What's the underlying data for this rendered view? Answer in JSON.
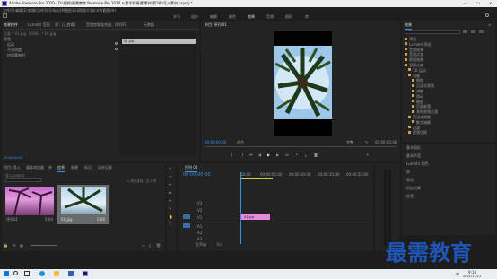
{
  "titlebar": {
    "title": "Adobe Premiere Pro 2020 - D:\\视频\\最需教育 Premiere Pro 2020 从零学到精通\\素材\\第3章\\导入素材.prproj *",
    "minimize": "—",
    "maximize": "☐",
    "close": "✕"
  },
  "menubar": [
    "文件(F)",
    "编辑(E)",
    "剪辑(C)",
    "序列(S)",
    "标记(M)",
    "图形(G)",
    "视图(V)",
    "窗口(W)",
    "帮助(H)"
  ],
  "workspaces": {
    "items": [
      "学习",
      "组件",
      "编辑",
      "颜色",
      "效果",
      "音频",
      "图形",
      "库"
    ],
    "active_index": 4
  },
  "source_panel": {
    "tabs": [
      "效果控件",
      "Lumetri 范围",
      "源：(无剪辑)",
      "音频剪辑混合器：序列01",
      "元数据"
    ],
    "active_index": 0,
    "sub_header": "主要 * 01.jpg",
    "sub_header2": "序列01 * 01.jpg",
    "video_label": "视频",
    "rows": [
      "运动",
      "不透明度",
      "时间重映射"
    ],
    "clip_label": "01.jpg",
    "timecode": "00:00:00:00"
  },
  "program_panel": {
    "tab": "节目: 序列 01",
    "timecode_left": "00:00:00:00",
    "fit": "适合",
    "quality": "完整",
    "timecode_right": "00:00:05:00"
  },
  "effects_panel": {
    "title": "效果",
    "search_placeholder": "",
    "tree": [
      {
        "label": "预设",
        "level": 0
      },
      {
        "label": "Lumetri 预设",
        "level": 0
      },
      {
        "label": "音频效果",
        "level": 0
      },
      {
        "label": "音频过渡",
        "level": 0
      },
      {
        "label": "视频效果",
        "level": 0
      },
      {
        "label": "视频过渡",
        "level": 0
      },
      {
        "label": "3D 运动",
        "level": 1
      },
      {
        "label": "划像",
        "level": 1
      },
      {
        "label": "擦除",
        "level": 2
      },
      {
        "label": "沉浸式视频",
        "level": 2
      },
      {
        "label": "溶解",
        "level": 2
      },
      {
        "label": "滑动",
        "level": 2
      },
      {
        "label": "缩放",
        "level": 2
      },
      {
        "label": "页面剥落",
        "level": 2
      },
      {
        "label": "其他视频过渡",
        "level": 2
      },
      {
        "label": "沉浸式视频",
        "level": 1
      },
      {
        "label": "数字溶解",
        "level": 2
      },
      {
        "label": "过渡",
        "level": 1
      },
      {
        "label": "视频切换",
        "level": 1
      }
    ]
  },
  "right_lower": {
    "items": [
      "基本图形",
      "基本声音",
      "Lumetri 颜色",
      "库",
      "标记",
      "历史记录",
      "信息"
    ]
  },
  "project_panel": {
    "tabs": [
      "项目: 导入",
      "媒体浏览器",
      "库",
      "信息",
      "效果",
      "标记",
      "历史记录"
    ],
    "active_index": 0,
    "path": "导入.prproj",
    "item_count": "1 项已选择，共 2 项",
    "items": [
      {
        "name": "01.jpg",
        "duration": "5:00"
      },
      {
        "name": "序列01",
        "duration": "5:00"
      }
    ]
  },
  "timeline": {
    "tab": "序列 01",
    "timecode": "00:00:00:00",
    "ruler": [
      "00:00",
      "00:00:05:00",
      "00:00:10:00",
      "00:00:15:00",
      "00:00:20:00"
    ],
    "tracks_video": [
      "V3",
      "V2",
      "V1"
    ],
    "tracks_audio": [
      "A1",
      "A2",
      "A3"
    ],
    "master": "主声道",
    "master_value": "0.0",
    "clip_label": "01.jpg"
  },
  "taskbar": {
    "time": "9:18",
    "date": "2021/11/12",
    "lang": "中"
  },
  "watermark": "最需教育",
  "colors": {
    "accent": "#3a8fe0",
    "clip_pink": "#e38ad8",
    "time_blue": "#3a8fe0"
  }
}
